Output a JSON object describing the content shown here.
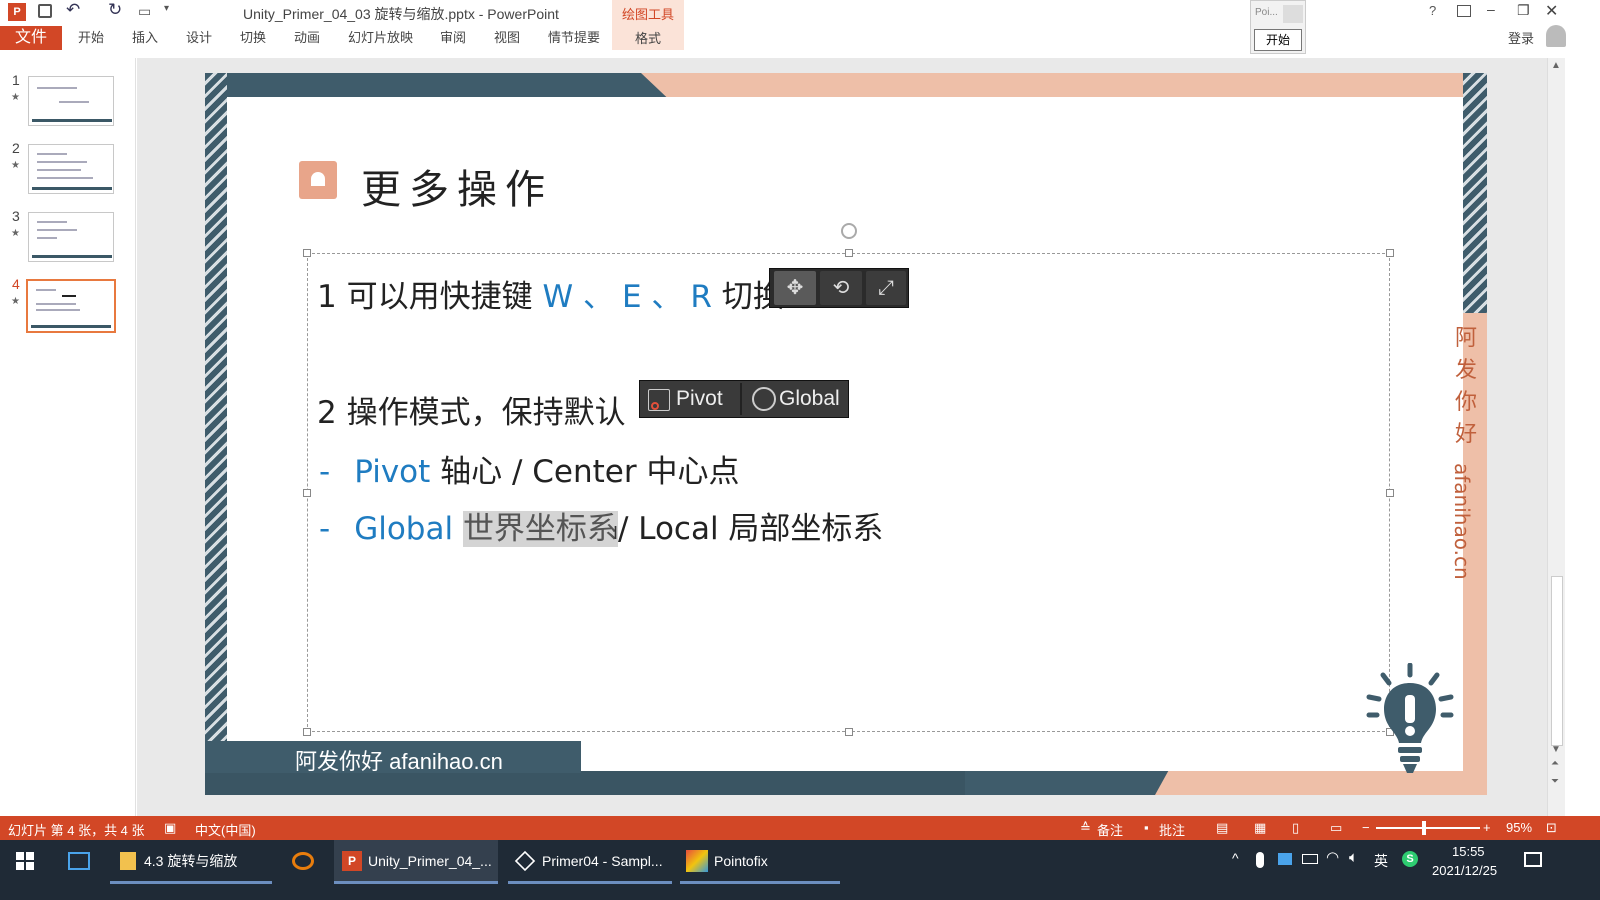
{
  "window": {
    "title": "Unity_Primer_04_03 旋转与缩放.pptx - PowerPoint",
    "sign_in": "登录",
    "help": "?"
  },
  "ribbon": {
    "tabs": [
      "文件",
      "开始",
      "插入",
      "设计",
      "切换",
      "动画",
      "幻灯片放映",
      "审阅",
      "视图",
      "情节提要"
    ],
    "contextual_group": "绘图工具",
    "contextual_tab": "格式"
  },
  "pointofix_popup": {
    "label": "Poi...",
    "start": "开始"
  },
  "thumbnails": [
    {
      "num": "1",
      "star": "★"
    },
    {
      "num": "2",
      "star": "★"
    },
    {
      "num": "3",
      "star": "★"
    },
    {
      "num": "4",
      "star": "★"
    }
  ],
  "slide": {
    "title": "更多操作",
    "line1_prefix": "1 可以用快捷键 ",
    "line1_w": "W",
    "line1_sep1": " 、",
    "line1_e": "E",
    "line1_sep2": " 、",
    "line1_r": "R",
    "line1_suffix": " 切换",
    "line2": "2 操作模式，保持默认",
    "pivot_btn": "Pivot",
    "global_btn": "Global",
    "bullet1_dash": "-",
    "bullet1_blue": "Pivot",
    "bullet1_rest": " 轴心 / Center 中心点",
    "bullet2_dash": "-",
    "bullet2_blue": "Global",
    "bullet2_hl": "世界坐标系",
    "bullet2_rest": "/ Local 局部坐标系",
    "side_chars": [
      "阿",
      "发",
      "你",
      "好"
    ],
    "side_url": "afanihao.cn",
    "footer": "阿发你好 afanihao.cn"
  },
  "statusbar": {
    "slide_info": "幻灯片 第 4 张，共 4 张",
    "language": "中文(中国)",
    "notes": "备注",
    "comments": "批注",
    "zoom": "95%"
  },
  "taskbar": {
    "items": [
      "4.3 旋转与缩放",
      "Unity_Primer_04_...",
      "Primer04 - Sampl...",
      "Pointofix"
    ],
    "ime": "英",
    "time": "15:55",
    "date": "2021/12/25"
  }
}
